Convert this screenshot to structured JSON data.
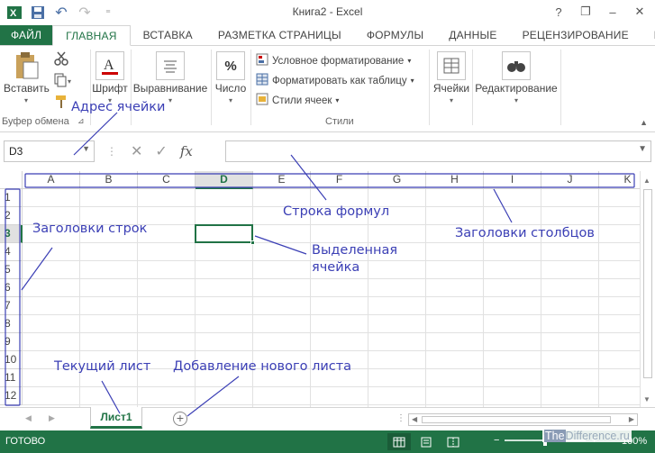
{
  "window": {
    "title": "Книга2 - Excel",
    "help": "?",
    "minimize": "–",
    "restore": "❐",
    "close": "✕"
  },
  "qat": {
    "save": "💾",
    "undo": "↶",
    "redo": "↷",
    "more": "⁼"
  },
  "tabs": [
    {
      "label": "ФАЙЛ"
    },
    {
      "label": "ГЛАВНАЯ"
    },
    {
      "label": "ВСТАВКА"
    },
    {
      "label": "РАЗМЕТКА СТРАНИЦЫ"
    },
    {
      "label": "ФОРМУЛЫ"
    },
    {
      "label": "ДАННЫЕ"
    },
    {
      "label": "РЕЦЕНЗИРОВАНИЕ"
    },
    {
      "label": "ВИ"
    }
  ],
  "ribbon": {
    "paste": "Вставить",
    "font": "Шрифт",
    "align": "Выравнивание",
    "number": "Число",
    "cond_format": "Условное форматирование",
    "format_table": "Форматировать как таблицу",
    "cell_styles": "Стили ячеек",
    "cells": "Ячейки",
    "editing": "Редактирование",
    "clipboard_group": "Буфер обмена",
    "styles_group": "Стили"
  },
  "formula_bar": {
    "name_box": "D3",
    "fx": "fx",
    "formula": ""
  },
  "columns": [
    "A",
    "B",
    "C",
    "D",
    "E",
    "F",
    "G",
    "H",
    "I",
    "J",
    "K"
  ],
  "rows": [
    "1",
    "2",
    "3",
    "4",
    "5",
    "6",
    "7",
    "8",
    "9",
    "10",
    "11",
    "12"
  ],
  "selected": {
    "col": "D",
    "row": "3"
  },
  "sheets": {
    "active": "Лист1",
    "add": "+"
  },
  "status": {
    "ready": "ГОТОВО",
    "zoom": "100%"
  },
  "watermark": {
    "prefix": "The",
    "rest": "Difference.ru"
  },
  "annotations": {
    "cell_address": "Адрес ячейки",
    "formula_bar": "Строка формул",
    "row_headers": "Заголовки строк",
    "selected_cell_1": "Выделенная",
    "selected_cell_2": "ячейка",
    "col_headers": "Заголовки столбцов",
    "current_sheet": "Текущий лист",
    "add_sheet": "Добавление нового листа"
  },
  "colors": {
    "accent": "#217346",
    "annotation": "#3b3fb5"
  }
}
